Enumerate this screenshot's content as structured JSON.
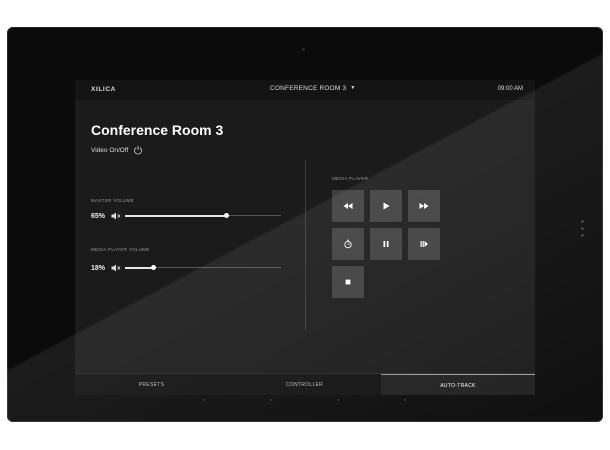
{
  "header": {
    "logo": "XILICA",
    "room_selector": "CONFERENCE ROOM 3",
    "time": "09:00 AM"
  },
  "page": {
    "title": "Conference Room 3",
    "video_toggle_label": "Video On/Off"
  },
  "master_volume": {
    "label": "MASTER VOLUME",
    "value_text": "65%",
    "level_fraction": 0.65
  },
  "media_player_volume": {
    "label": "MEDIA PLAYER VOLUME",
    "value_text": "18%",
    "level_fraction": 0.18
  },
  "media_player": {
    "label": "MEDIA PLAYER",
    "buttons": [
      "rewind-icon",
      "play-icon",
      "fast-forward-icon",
      "timer-icon",
      "pause-icon",
      "step-forward-icon",
      "stop-icon"
    ]
  },
  "tabs": [
    {
      "label": "PRESETS",
      "active": false
    },
    {
      "label": "CONTROLLER",
      "active": false
    },
    {
      "label": "AUTO-TRACK",
      "active": true
    }
  ],
  "colors": {
    "bezel": "#0b0b0b",
    "screen_bg": "#1b1b1b",
    "button_bg": "#3f3f3f",
    "text": "#ffffff"
  }
}
